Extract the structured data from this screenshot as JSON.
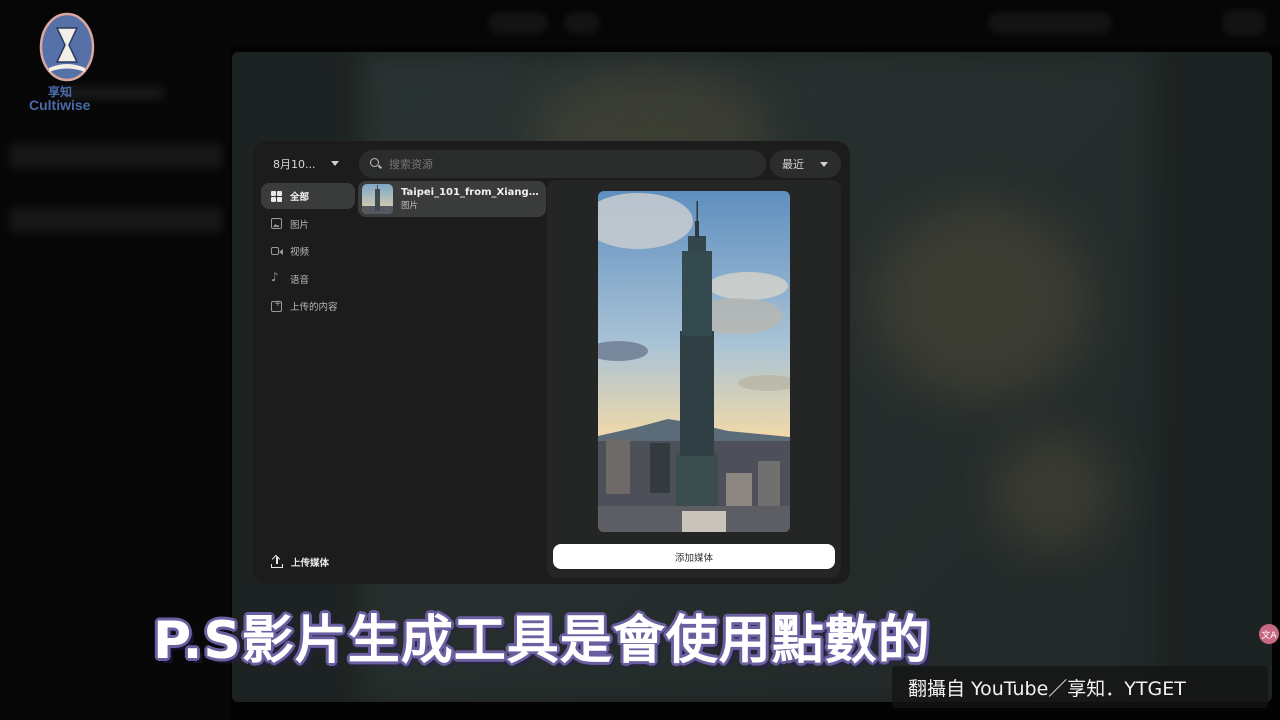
{
  "dialog": {
    "date_filter": "8月10...",
    "search_placeholder": "搜索资源",
    "sort_label": "最近",
    "nav_items": [
      {
        "label": "全部",
        "icon": "grid-icon",
        "active": true
      },
      {
        "label": "图片",
        "icon": "image-icon",
        "active": false
      },
      {
        "label": "视频",
        "icon": "video-icon",
        "active": false
      },
      {
        "label": "语音",
        "icon": "audio-icon",
        "active": false
      },
      {
        "label": "上传的内容",
        "icon": "upload-folder-icon",
        "active": false
      }
    ],
    "upload_label": "上传媒体",
    "file": {
      "name": "Taipei_101_from_Xiangs...",
      "type": "图片"
    },
    "add_button": "添加媒体"
  },
  "logo": {
    "cn": "享知",
    "en": "Cultiwise"
  },
  "caption": "P.S影片生成工具是會使用點數的",
  "credit": "翻攝自 YouTube／享知．YTGET",
  "translate_badge": "文A",
  "colors": {
    "dialog_bg": "#1b1c1b",
    "active_item": "#3a3b3b",
    "caption_outline": "#6a5fa0",
    "logo_blue": "#4b6aa8"
  }
}
